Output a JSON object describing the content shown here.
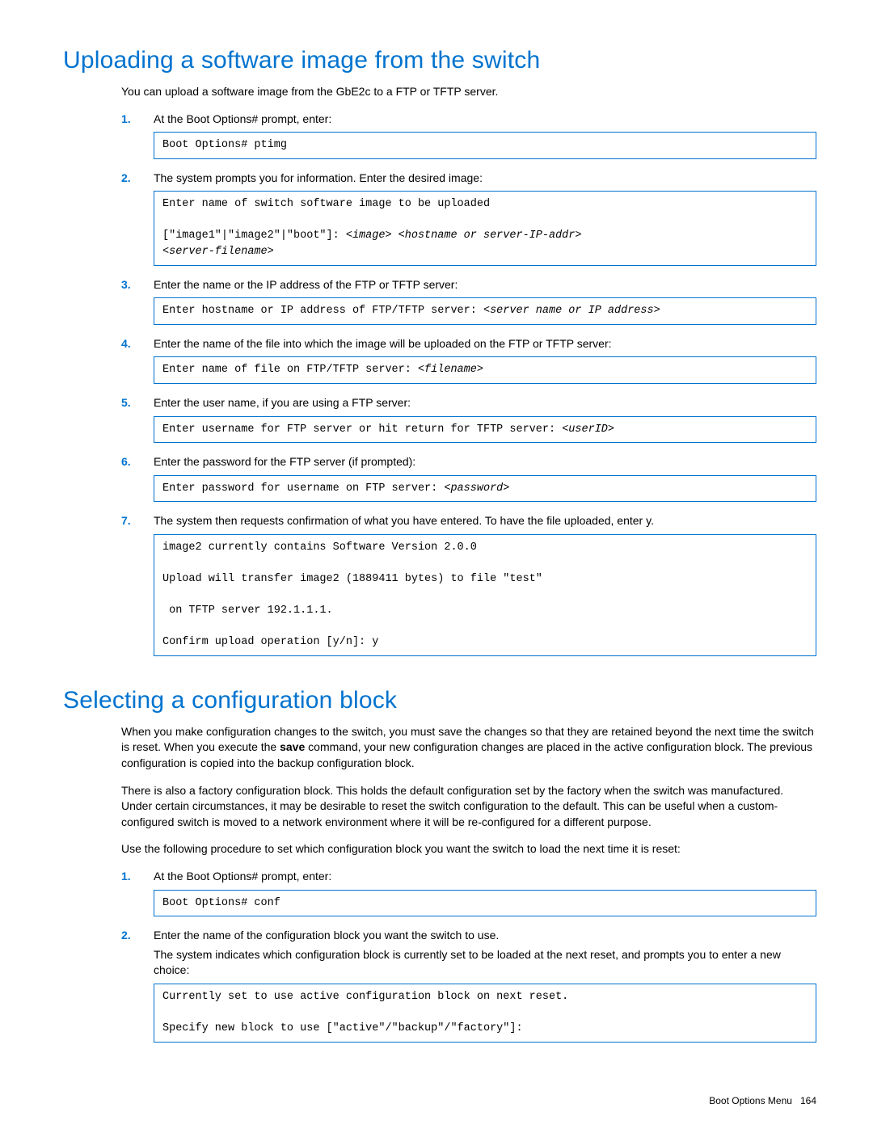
{
  "section1": {
    "title": "Uploading a software image from the switch",
    "intro": "You can upload a software image from the GbE2c to a FTP or TFTP server.",
    "steps": [
      {
        "text": "At the Boot Options# prompt, enter:",
        "code_plain": "Boot Options# ptimg"
      },
      {
        "text": "The system prompts you for information.  Enter the desired image:",
        "code_line1": "Enter name of switch software image to be uploaded",
        "code_blank": "",
        "code_line2a": "[\"image1\"|\"image2\"|\"boot\"]: ",
        "code_line2b_i": "<image> <hostname or server-IP-addr>",
        "code_line3_i": "<server-filename>"
      },
      {
        "text": "Enter the name or the IP address of the FTP or TFTP server:",
        "code_a": "Enter hostname or IP address of FTP/TFTP server: ",
        "code_b_i": "<server name or IP address>"
      },
      {
        "text": "Enter the name of the file into which the image will be uploaded on the FTP or TFTP server:",
        "code_a": "Enter name of file on FTP/TFTP server: ",
        "code_b_i": "<filename>"
      },
      {
        "text": "Enter the user name, if you are using a FTP server:",
        "code_a": "Enter username for FTP server or hit return for TFTP server: ",
        "code_b_i": "<userID>"
      },
      {
        "text": "Enter the password for the FTP server (if prompted):",
        "code_a": "Enter password for username on FTP server: ",
        "code_b_i": "<password>"
      },
      {
        "text": "The system then requests confirmation of what you have entered. To have the file uploaded, enter y.",
        "code_multi": "image2 currently contains Software Version 2.0.0\n\nUpload will transfer image2 (1889411 bytes) to file \"test\"\n\n on TFTP server 192.1.1.1.\n\nConfirm upload operation [y/n]: y"
      }
    ]
  },
  "section2": {
    "title": "Selecting a configuration block",
    "p1a": "When you make configuration changes to the switch, you must save the changes so that they are retained beyond the next time the switch is reset. When you execute the ",
    "p1b_bold": "save",
    "p1c": " command, your new configuration changes are placed in the active configuration block. The previous configuration is copied into the backup configuration block.",
    "p2": "There is also a factory configuration block. This holds the default configuration set by the factory when the switch was manufactured. Under certain circumstances, it may be desirable to reset the switch configuration to the default. This can be useful when a custom-configured switch is moved to a network environment where it will be re-configured for a different purpose.",
    "p3": "Use the following procedure to set which configuration block you want the switch to load the next time it is reset:",
    "steps": [
      {
        "text": "At the Boot Options# prompt, enter:",
        "code_plain": "Boot Options# conf"
      },
      {
        "text": "Enter the name of the configuration block you want the switch to use.",
        "sub": "The system indicates which configuration block is currently set to be loaded at the next reset, and prompts you to enter a new choice:",
        "code_multi": "Currently set to use active configuration block on next reset.\n\nSpecify new block to use [\"active\"/\"backup\"/\"factory\"]:"
      }
    ]
  },
  "footer": {
    "label": "Boot Options Menu",
    "page": "164"
  }
}
